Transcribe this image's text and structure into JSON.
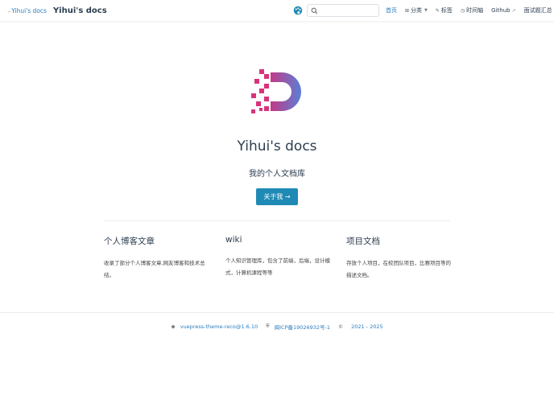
{
  "navbar": {
    "logo_alt": "Yihui's docs",
    "title": "Yihui's docs",
    "search": {
      "value": "",
      "placeholder": ""
    },
    "links": [
      {
        "label": "首页",
        "active": true
      },
      {
        "label": "分类",
        "icon": "grid-icon",
        "dropdown": true
      },
      {
        "label": "标签",
        "icon": "tag-icon"
      },
      {
        "label": "时间轴",
        "icon": "clock-icon"
      },
      {
        "label": "Github",
        "icon_after": "external-link-icon"
      },
      {
        "label": "面试题汇总"
      }
    ]
  },
  "hero": {
    "title": "Yihui's docs",
    "description": "我的个人文档库",
    "button_label": "关于我 →"
  },
  "features": [
    {
      "title": "个人博客文章",
      "description": "收录了部分个人博客文章,网友博客和技术总结。"
    },
    {
      "title": "wiki",
      "description": "个人知识管理库，包含了前端，后端，设计模式，计算机课程等等"
    },
    {
      "title": "项目文档",
      "description": "存放个人项目，在校团队项目，比赛项目等的描述文档。"
    }
  ],
  "footer": {
    "theme": "vuepress-theme-reco@1.6.10",
    "icp": "闽ICP备19026932号-1",
    "years": "2021 - 2025"
  },
  "colors": {
    "accent": "#1f8ab5",
    "link": "#2a7dbd",
    "logo_pink": "#d8337a",
    "logo_blue": "#5b7fd6"
  }
}
